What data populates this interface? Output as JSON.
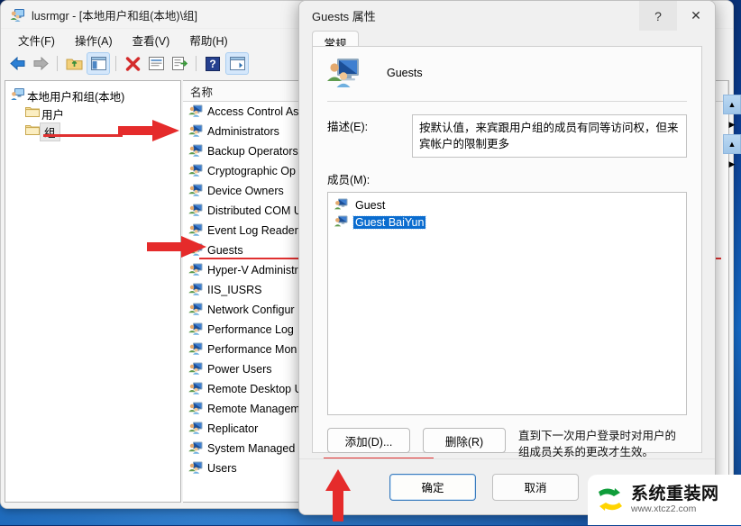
{
  "window": {
    "title": "lusrmgr - [本地用户和组(本地)\\组]",
    "title_icon": "computer-users-icon",
    "menu": [
      {
        "label": "文件(F)",
        "name": "menu-file"
      },
      {
        "label": "操作(A)",
        "name": "menu-action"
      },
      {
        "label": "查看(V)",
        "name": "menu-view"
      },
      {
        "label": "帮助(H)",
        "name": "menu-help"
      }
    ],
    "toolbar": [
      {
        "name": "back-icon",
        "glyph": "back"
      },
      {
        "name": "forward-icon",
        "glyph": "forward"
      },
      {
        "name": "up-folder-icon",
        "glyph": "folderup"
      },
      {
        "name": "show-tree-icon",
        "glyph": "panel",
        "selected": true
      },
      {
        "name": "delete-icon",
        "glyph": "cross"
      },
      {
        "name": "properties-icon",
        "glyph": "props"
      },
      {
        "name": "export-list-icon",
        "glyph": "export"
      },
      {
        "name": "help-icon",
        "glyph": "help"
      },
      {
        "name": "show-pane-icon",
        "glyph": "panel2",
        "selected": true
      }
    ]
  },
  "tree": {
    "root": {
      "label": "本地用户和组(本地)",
      "icon": "computer-icon"
    },
    "children": [
      {
        "label": "用户",
        "icon": "folder-icon",
        "selected": false
      },
      {
        "label": "组",
        "icon": "folder-icon",
        "selected": true
      }
    ]
  },
  "list": {
    "column_header": "名称",
    "rows": [
      {
        "label": "Access Control As",
        "icon": "group-icon",
        "highlighted": false
      },
      {
        "label": "Administrators",
        "icon": "group-icon",
        "highlighted": false
      },
      {
        "label": "Backup Operators",
        "icon": "group-icon",
        "highlighted": false
      },
      {
        "label": "Cryptographic Op",
        "icon": "group-icon",
        "highlighted": false
      },
      {
        "label": "Device Owners",
        "icon": "group-icon",
        "highlighted": false
      },
      {
        "label": "Distributed COM U",
        "icon": "group-icon",
        "highlighted": false
      },
      {
        "label": "Event Log Readers",
        "icon": "group-icon",
        "highlighted": false
      },
      {
        "label": "Guests",
        "icon": "group-icon",
        "highlighted": true
      },
      {
        "label": "Hyper-V Administr",
        "icon": "group-icon",
        "highlighted": false
      },
      {
        "label": "IIS_IUSRS",
        "icon": "group-icon",
        "highlighted": false
      },
      {
        "label": "Network Configur",
        "icon": "group-icon",
        "highlighted": false
      },
      {
        "label": "Performance Log",
        "icon": "group-icon",
        "highlighted": false
      },
      {
        "label": "Performance Mon",
        "icon": "group-icon",
        "highlighted": false
      },
      {
        "label": "Power Users",
        "icon": "group-icon",
        "highlighted": false
      },
      {
        "label": "Remote Desktop U",
        "icon": "group-icon",
        "highlighted": false
      },
      {
        "label": "Remote Managem",
        "icon": "group-icon",
        "highlighted": false
      },
      {
        "label": "Replicator",
        "icon": "group-icon",
        "highlighted": false
      },
      {
        "label": "System Managed",
        "icon": "group-icon",
        "highlighted": false
      },
      {
        "label": "Users",
        "icon": "group-icon",
        "highlighted": false
      }
    ]
  },
  "dialog": {
    "title": "Guests 属性",
    "help_button": "?",
    "close_button": "✕",
    "tab": "常规",
    "group_icon": "group-large-icon",
    "group_name": "Guests",
    "description_label": "描述(E):",
    "description_value": "按默认值，来宾跟用户组的成员有同等访问权，但来宾帐户的限制更多",
    "members_label": "成员(M):",
    "members": [
      {
        "label": "Guest",
        "icon": "user-icon",
        "selected": false
      },
      {
        "label": "Guest BaiYun",
        "icon": "user-icon",
        "selected": true
      }
    ],
    "add_button": "添加(D)...",
    "remove_button": "删除(R)",
    "note": "直到下一次用户登录时对用户的组成员关系的更改才生效。",
    "ok_button": "确定",
    "cancel_button": "取消"
  },
  "watermark": {
    "title": "系统重装网",
    "url": "www.xtcz2.com",
    "logo": "recycle-logo"
  },
  "colors": {
    "annotation_red": "#e03030",
    "selection_blue": "#0a6ccf",
    "accent_blue": "#3a7cbd"
  }
}
